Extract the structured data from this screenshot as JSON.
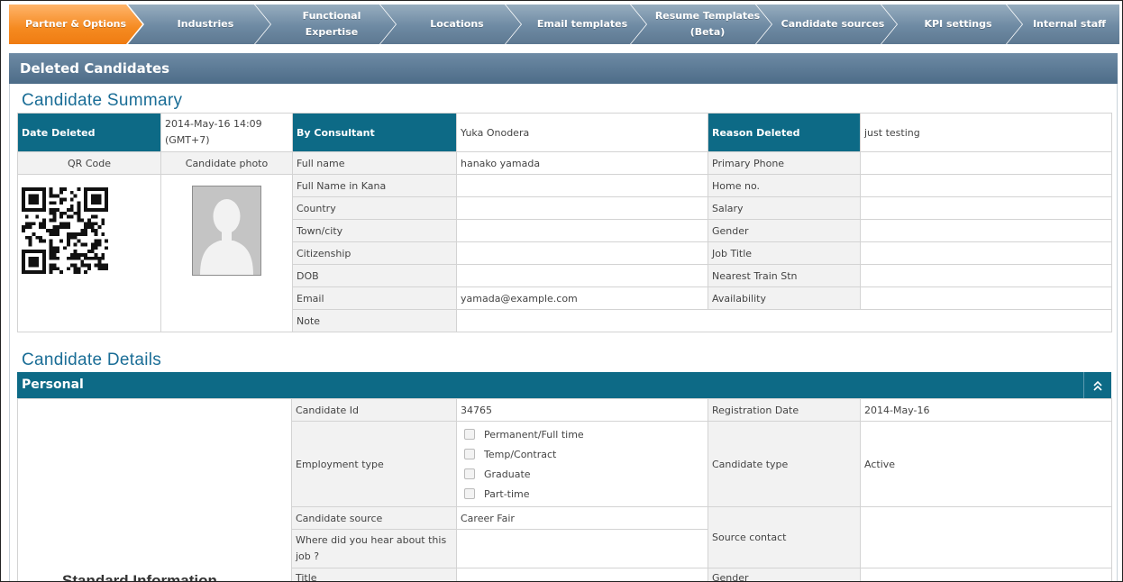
{
  "steps": [
    {
      "label": "Partner & Options",
      "active": true
    },
    {
      "label": "Industries"
    },
    {
      "label": "Functional\nExpertise"
    },
    {
      "label": "Locations"
    },
    {
      "label": "Email templates"
    },
    {
      "label": "Resume Templates\n(Beta)"
    },
    {
      "label": "Candidate sources"
    },
    {
      "label": "KPI settings"
    },
    {
      "label": "Internal staff"
    }
  ],
  "section_title": "Deleted Candidates",
  "summary": {
    "heading": "Candidate Summary",
    "date_deleted_label": "Date Deleted",
    "date_deleted_value": "2014-May-16 14:09 (GMT+7)",
    "by_consultant_label": "By Consultant",
    "by_consultant_value": "Yuka Onodera",
    "reason_label": "Reason Deleted",
    "reason_value": "just testing",
    "qr_label": "QR Code",
    "photo_label": "Candidate photo",
    "fields_left": [
      {
        "label": "Full name",
        "value": "hanako yamada"
      },
      {
        "label": "Full Name in Kana",
        "value": ""
      },
      {
        "label": "Country",
        "value": ""
      },
      {
        "label": "Town/city",
        "value": ""
      },
      {
        "label": "Citizenship",
        "value": ""
      },
      {
        "label": "DOB",
        "value": ""
      },
      {
        "label": "Email",
        "value": "yamada@example.com"
      },
      {
        "label": "Note",
        "value": ""
      }
    ],
    "fields_right": [
      {
        "label": "Primary Phone",
        "value": ""
      },
      {
        "label": "Home no.",
        "value": ""
      },
      {
        "label": "Salary",
        "value": ""
      },
      {
        "label": "Gender",
        "value": ""
      },
      {
        "label": "Job Title",
        "value": ""
      },
      {
        "label": "Nearest Train Stn",
        "value": ""
      },
      {
        "label": "Availability",
        "value": ""
      }
    ]
  },
  "details": {
    "heading": "Candidate Details",
    "personal_label": "Personal",
    "side_label": "Standard Information",
    "candidate_id_label": "Candidate Id",
    "candidate_id_value": "34765",
    "registration_label": "Registration Date",
    "registration_value": "2014-May-16",
    "employment_label": "Employment type",
    "employment_options": [
      "Permanent/Full time",
      "Temp/Contract",
      "Graduate",
      "Part-time"
    ],
    "candidate_type_label": "Candidate type",
    "candidate_type_value": "Active",
    "source_label": "Candidate source",
    "source_value": "Career Fair",
    "source_contact_label": "Source contact",
    "hear_label": "Where did you hear about this job ?",
    "title_label": "Title",
    "gender_label": "Gender"
  },
  "colors": {
    "accent": "#0d6a86",
    "heading": "#1a6d96",
    "active_step": "#f58a20",
    "step": "#6e8aa3"
  },
  "icons": {
    "collapse": "double-chevron-up-icon",
    "qr": "qr-code-image",
    "photo": "person-silhouette-placeholder"
  }
}
